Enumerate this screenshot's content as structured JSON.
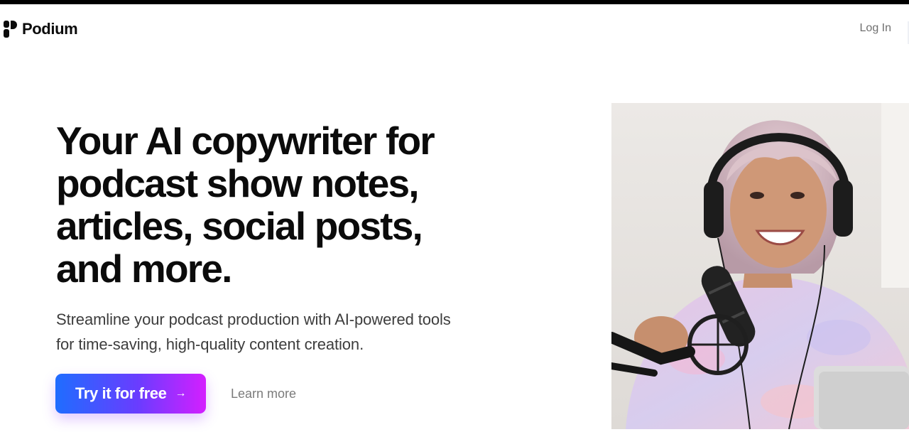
{
  "nav": {
    "brand": "Podium",
    "login_label": "Log In"
  },
  "hero": {
    "title_lines": [
      "Your AI copywriter for",
      "podcast show notes,",
      "articles, social posts,",
      "and more."
    ],
    "subtitle_lines": [
      "Streamline your podcast production with AI-powered tools",
      "for time-saving, high-quality content creation."
    ],
    "cta_label": "Try it for free",
    "cta_icon": "arrow-right-icon",
    "secondary_label": "Learn more"
  },
  "colors": {
    "cta_gradient": [
      "#1f6dff",
      "#6a3cff",
      "#d41fff"
    ],
    "text": "#0b0b0b",
    "muted": "#6f6f6f"
  }
}
